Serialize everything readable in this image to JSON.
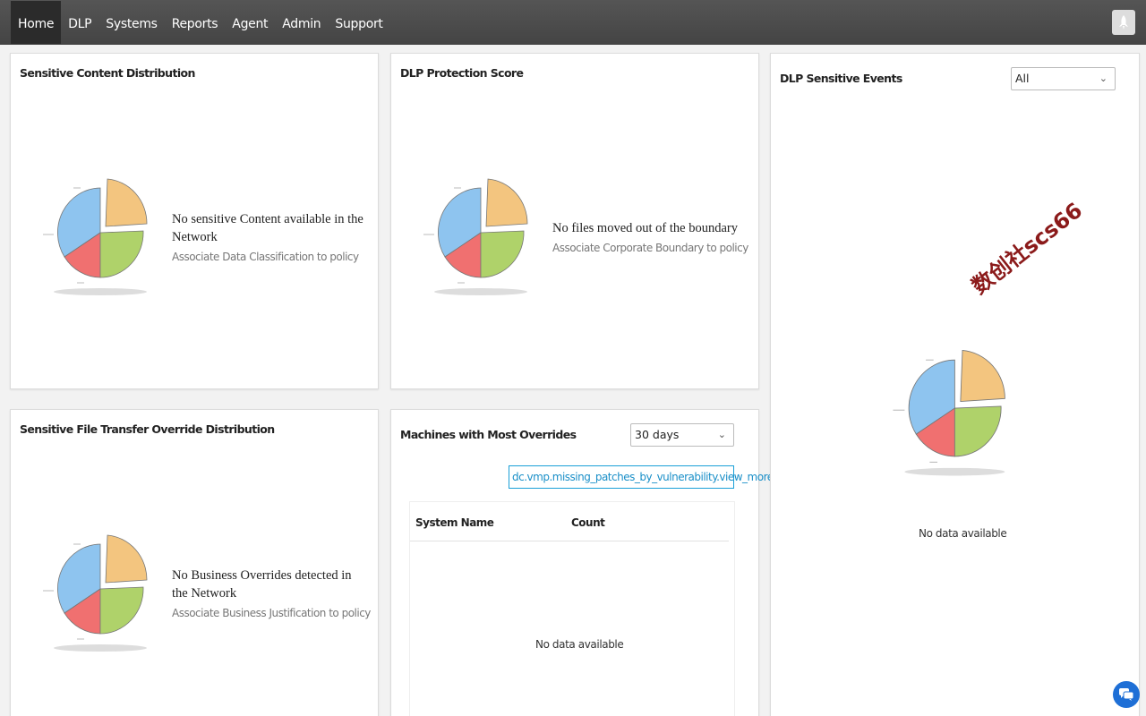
{
  "nav": {
    "items": [
      {
        "label": "Home",
        "active": true
      },
      {
        "label": "DLP"
      },
      {
        "label": "Systems"
      },
      {
        "label": "Reports"
      },
      {
        "label": "Agent"
      },
      {
        "label": "Admin"
      },
      {
        "label": "Support"
      }
    ],
    "rocket_icon": "rocket-icon"
  },
  "colors": {
    "pie_blue": "#8ec4ef",
    "pie_orange": "#f3c57f",
    "pie_green": "#afd26a",
    "pie_red": "#f07070",
    "link": "#1a8fc8"
  },
  "cards": {
    "sensitive_content": {
      "title": "Sensitive Content Distribution",
      "message": "No sensitive Content available in the Network",
      "sub": "Associate Data Classification to policy"
    },
    "protection_score": {
      "title": "DLP Protection Score",
      "message": "No files moved out of the boundary",
      "sub": "Associate Corporate Boundary to policy"
    },
    "override_distribution": {
      "title": "Sensitive File Transfer Override Distribution",
      "message": "No Business Overrides detected in the Network",
      "sub": "Associate Business Justification to policy"
    },
    "machines_overrides": {
      "title": "Machines with Most Overrides",
      "period": "30 days",
      "view_more": "dc.vmp.missing_patches_by_vulnerability.view_more",
      "columns": [
        "System Name",
        "Count"
      ],
      "empty": "No data available"
    },
    "sensitive_events": {
      "title": "DLP Sensitive Events",
      "filter": "All",
      "empty": "No data available"
    }
  },
  "watermark": "数创社scs66",
  "chat_icon": "chat-icon"
}
